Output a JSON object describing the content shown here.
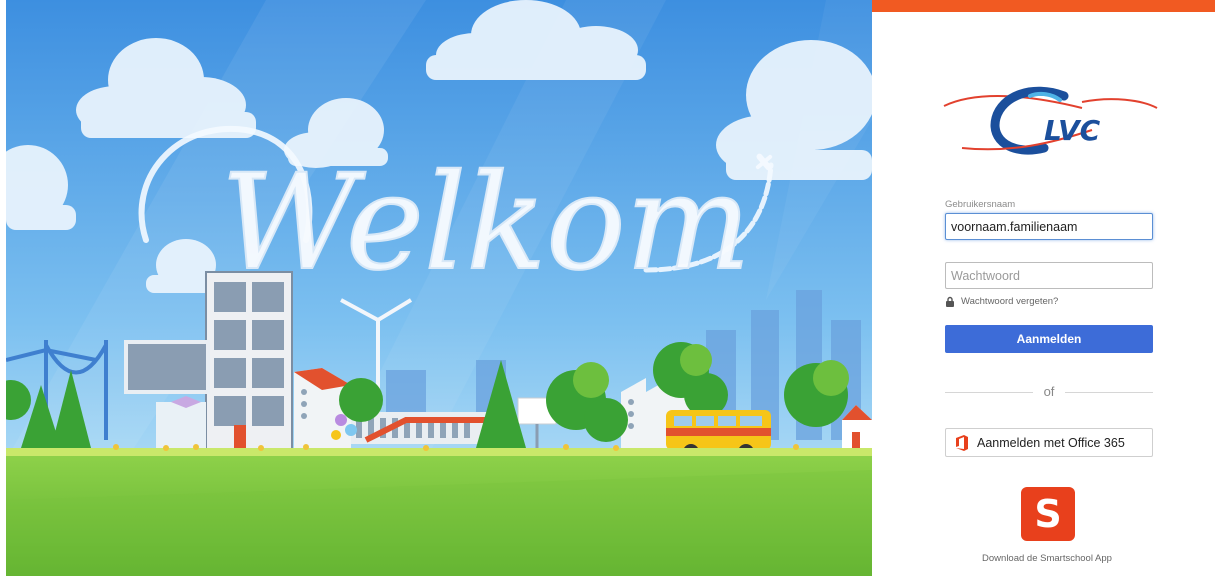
{
  "hero": {
    "welcome_text": "Welkom"
  },
  "brand": {
    "name": "LVC",
    "accent_top_bar": "#f15a22",
    "primary_button": "#3d6cd8",
    "app_icon_color": "#e8401c",
    "office_icon_color": "#e8401c"
  },
  "login": {
    "username_label": "Gebruikersnaam",
    "username_value": "voornaam.familienaam",
    "password_placeholder": "Wachtwoord",
    "forgot_password": "Wachtwoord vergeten?",
    "submit_label": "Aanmelden",
    "separator": "of",
    "office_label": "Aanmelden met Office 365"
  },
  "app": {
    "icon_letter": "S",
    "download_label": "Download de Smartschool App"
  },
  "icons": {
    "lock": "lock-icon",
    "office": "office-365-icon",
    "smartschool": "smartschool-app-icon"
  }
}
